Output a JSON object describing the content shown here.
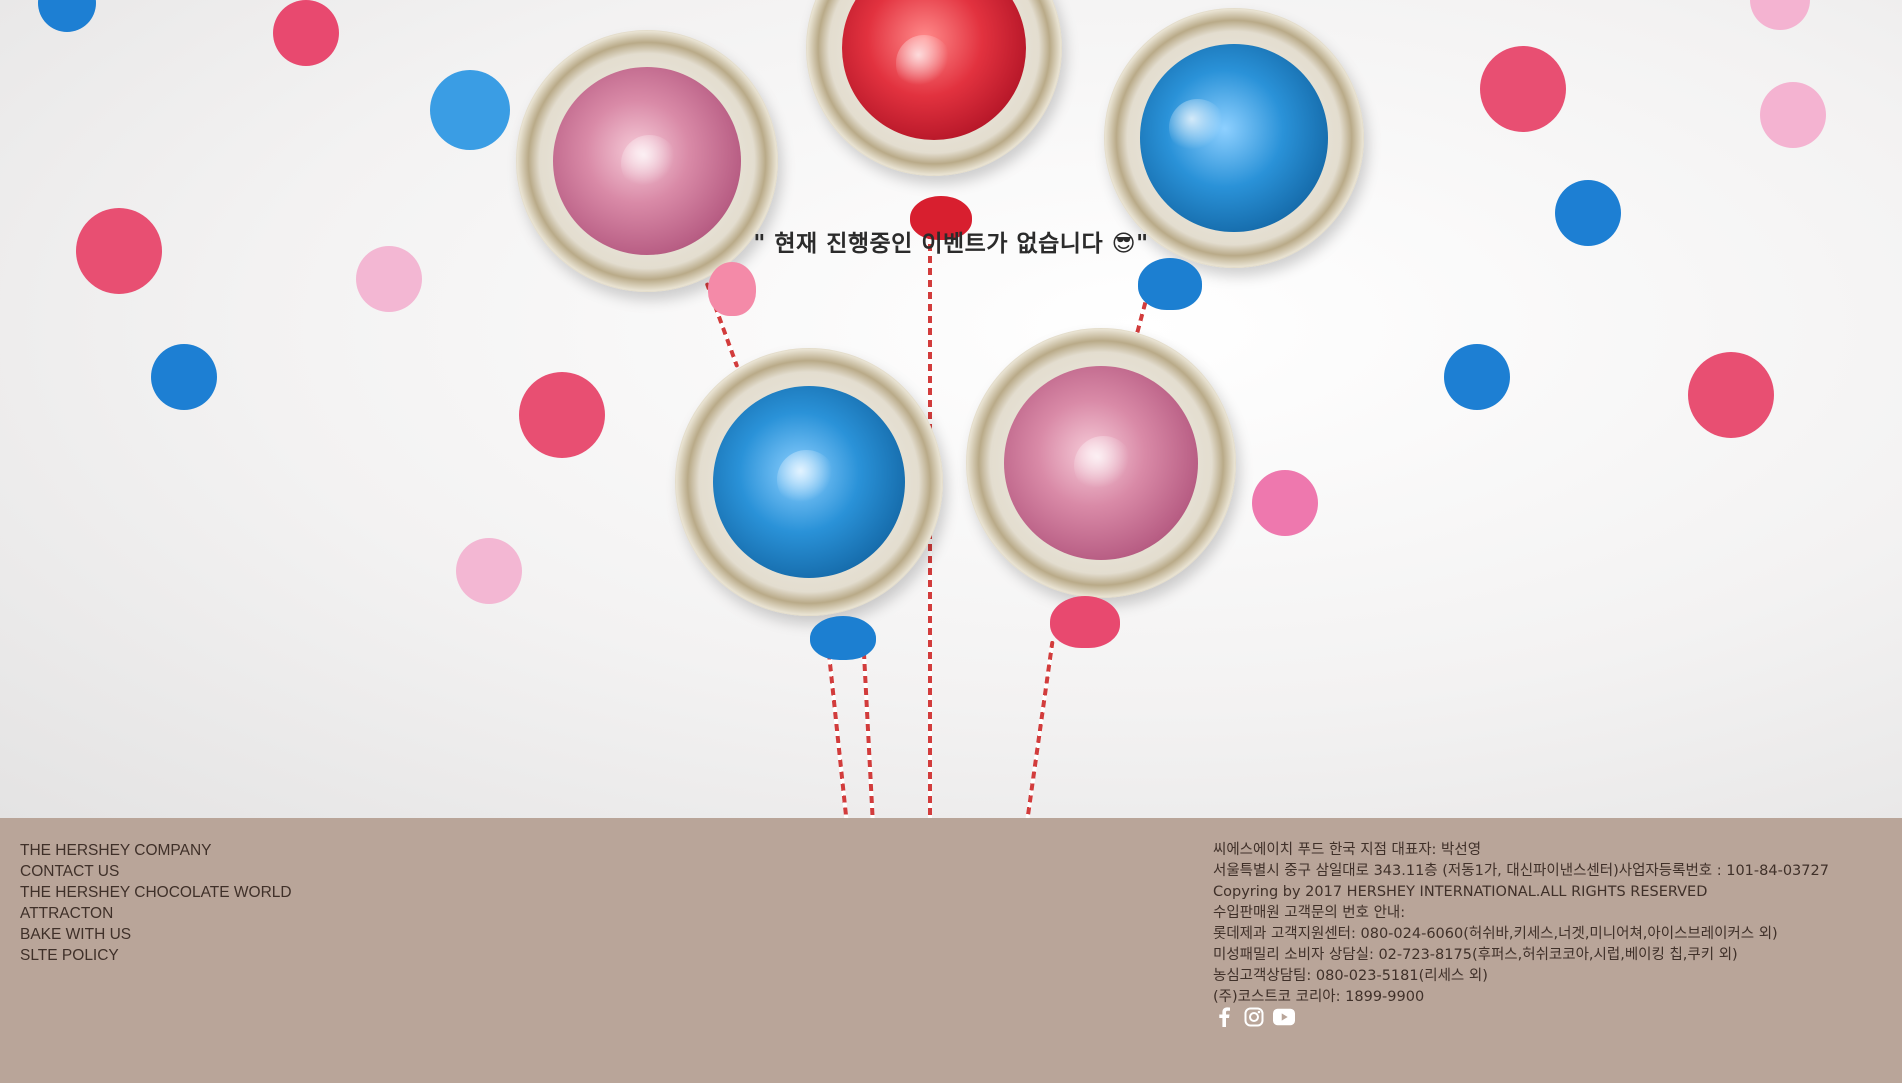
{
  "hero": {
    "message": "\" 현재 진행중인 이벤트가 없습니다 😎\"",
    "image_icon": "kisses-jars-balloons-image"
  },
  "footer": {
    "links": [
      "THE HERSHEY COMPANY",
      "CONTACT US",
      "THE HERSHEY CHOCOLATE WORLD",
      "ATTRACTON",
      "BAKE WITH US",
      "SLTE POLICY"
    ],
    "info": [
      "씨에스에이치 푸드 한국 지점 대표자: 박선영",
      "서울특별시 중구 삼일대로 343.11층 (저동1가, 대신파이낸스센터)사업자등록번호 : 101-84-03727",
      "Copyring by 2017 HERSHEY INTERNATIONAL.ALL RIGHTS RESERVED",
      "수입판매원 고객문의 번호 안내:",
      "롯데제과 고객지원센터: 080-024-6060(허쉬바,키세스,너겟,미니어쳐,아이스브레이커스 외)",
      "미성패밀리 소비자 상담실: 02-723-8175(후퍼스,허쉬코코아,시럽,베이킹 칩,쿠키 외)",
      "농심고객상담팀: 080-023-5181(리세스 외)",
      "(주)코스트코 코리아: 1899-9900"
    ],
    "social": [
      "facebook-icon",
      "instagram-icon",
      "youtube-icon"
    ]
  },
  "colors": {
    "footer_bg": "#b9a599",
    "footer_text": "#3f3029",
    "dot_pink": "#e8496f",
    "dot_light_pink": "#f4b3d1",
    "dot_blue": "#1d7fd3"
  }
}
